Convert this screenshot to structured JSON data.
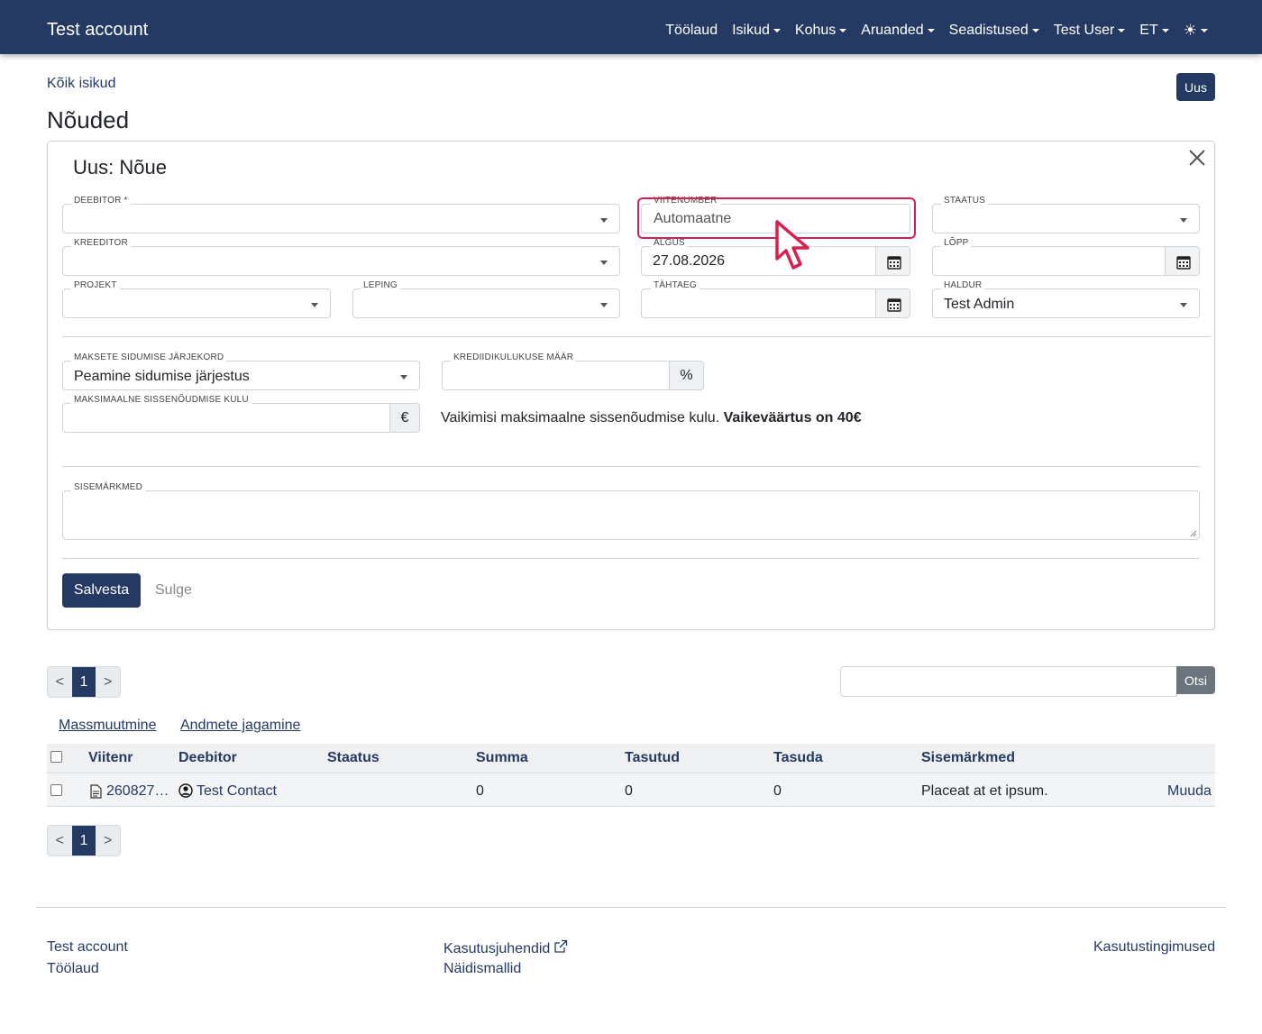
{
  "nav": {
    "brand": "Test account",
    "items": [
      {
        "label": "Töölaud",
        "caret": false
      },
      {
        "label": "Isikud",
        "caret": true
      },
      {
        "label": "Kohus",
        "caret": true
      },
      {
        "label": "Aruanded",
        "caret": true
      },
      {
        "label": "Seadistused",
        "caret": true
      },
      {
        "label": "Test User",
        "caret": true
      },
      {
        "label": "ET",
        "caret": true
      }
    ],
    "theme_icon": "☀"
  },
  "breadcrumb": "Kõik isikud",
  "new_button": "Uus",
  "page_title": "Nõuded",
  "form": {
    "title": "Uus: Nõue",
    "deebitor": {
      "label": "DEEBITOR *",
      "value": ""
    },
    "viitenumber": {
      "label": "VIITENUMBER",
      "value": "Automaatne"
    },
    "staatus": {
      "label": "STAATUS",
      "value": ""
    },
    "kreeditor": {
      "label": "KREEDITOR",
      "value": ""
    },
    "algus": {
      "label": "ALGUS",
      "value": "27.08.2026"
    },
    "lopp": {
      "label": "LÕPP",
      "value": ""
    },
    "projekt": {
      "label": "PROJEKT",
      "value": ""
    },
    "leping": {
      "label": "LEPING",
      "value": ""
    },
    "tahtaeg": {
      "label": "TÄHTAEG",
      "value": ""
    },
    "haldur": {
      "label": "HALDUR",
      "value": "Test Admin"
    },
    "maksete_jarjekord": {
      "label": "MAKSETE SIDUMISE JÄRJEKORD",
      "value": "Peamine sidumise järjestus"
    },
    "krediidikulukuse": {
      "label": "KREDIIDIKULUKUSE MÄÄR",
      "value": "",
      "unit": "%"
    },
    "max_kulu": {
      "label": "MAKSIMAALNE SISSENÕUDMISE KULU",
      "value": "",
      "unit": "€"
    },
    "hint_text": "Vaikimisi maksimaalne sissenõudmise kulu.",
    "hint_bold": "Vaikeväärtus on 40€",
    "sisemarkmed": {
      "label": "SISEMÄRKMED",
      "value": ""
    },
    "save_button": "Salvesta",
    "close_button": "Sulge"
  },
  "pagination": {
    "prev": "<",
    "page": "1",
    "next": ">"
  },
  "search": {
    "value": "",
    "button": "Otsi"
  },
  "actions": {
    "mass": "Massmuutmine",
    "share": "Andmete jagamine"
  },
  "table": {
    "columns": [
      "Viitenr",
      "Deebitor",
      "Staatus",
      "Summa",
      "Tasutud",
      "Tasuda",
      "Sisemärkmed"
    ],
    "rows": [
      {
        "viitenr": "260827…",
        "deebitor": "Test Contact",
        "staatus": "",
        "summa": "0",
        "tasutud": "0",
        "tasuda": "0",
        "sisemarkmed": "Placeat at et ipsum.",
        "edit": "Muuda"
      }
    ]
  },
  "footer": {
    "col1": [
      "Test account",
      "Töölaud"
    ],
    "col2": [
      "Kasutusjuhendid",
      "Näidismallid"
    ],
    "col3": [
      "Kasutustingimused"
    ]
  },
  "colors": {
    "primary": "#243a63",
    "highlight": "#d6204f",
    "secondary": "#6c757d"
  }
}
